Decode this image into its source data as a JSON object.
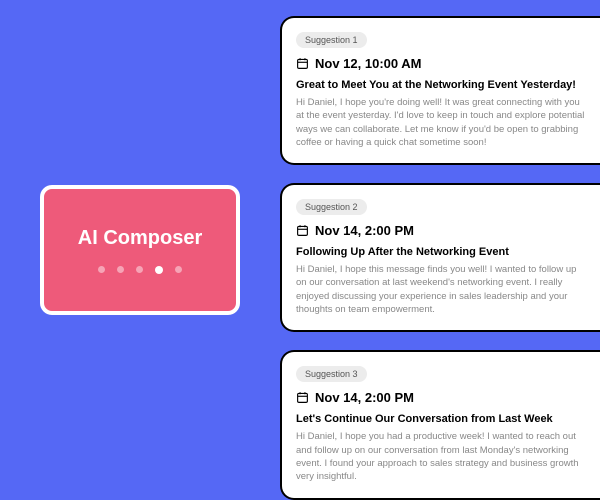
{
  "composer": {
    "title": "AI Composer",
    "active_dot_index": 3,
    "dot_count": 5
  },
  "suggestions": [
    {
      "badge": "Suggestion 1",
      "datetime": "Nov 12, 10:00 AM",
      "subject": "Great to Meet You at the Networking Event Yesterday!",
      "body": "Hi Daniel,  I hope you're doing well! It was great connecting with you at the event yesterday. I'd love to keep in touch and explore potential ways we can collaborate. Let me know if you'd be open to grabbing coffee or having a quick chat sometime soon!"
    },
    {
      "badge": "Suggestion 2",
      "datetime": "Nov 14, 2:00 PM",
      "subject": "Following Up After the Networking Event",
      "body": "Hi Daniel,  I hope this message finds you well! I wanted to follow up on our conversation at last weekend's networking event. I really enjoyed discussing your experience in sales leadership and your thoughts on team empowerment."
    },
    {
      "badge": "Suggestion 3",
      "datetime": "Nov 14, 2:00 PM",
      "subject": "Let's Continue Our Conversation from Last Week",
      "body": "Hi Daniel,  I hope you had a productive week! I wanted to reach out and follow up on our conversation from last Monday's networking event. I found your approach to sales strategy and business growth very insightful."
    }
  ]
}
